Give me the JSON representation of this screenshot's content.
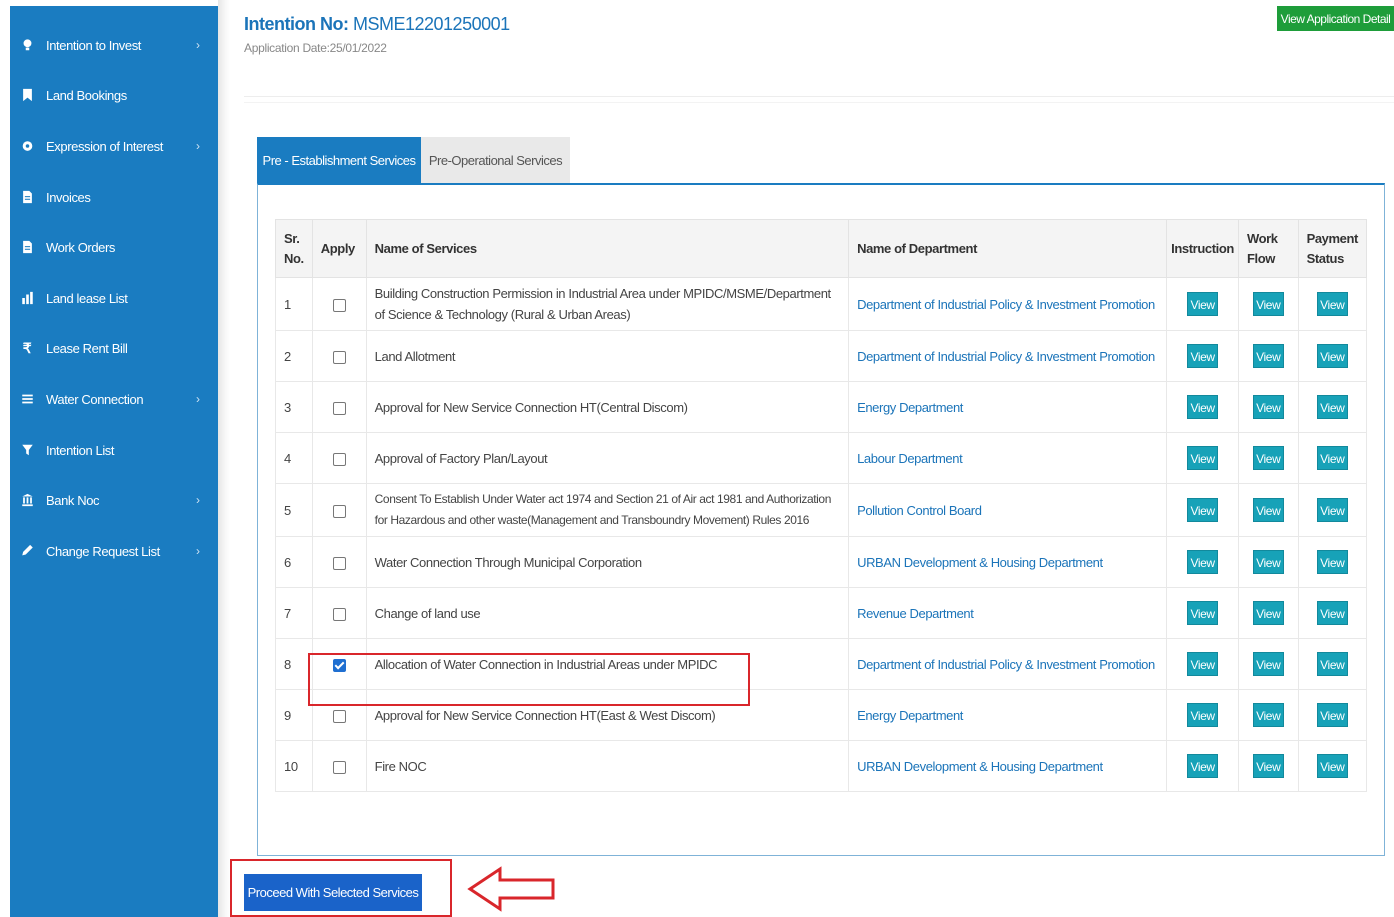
{
  "sidebar": {
    "items": [
      {
        "label": "Intention to Invest",
        "icon": "bulb-icon",
        "has_submenu": true
      },
      {
        "label": "Land Bookings",
        "icon": "bookmark-icon",
        "has_submenu": false
      },
      {
        "label": "Expression of Interest",
        "icon": "gear-icon",
        "has_submenu": true
      },
      {
        "label": "Invoices",
        "icon": "document-icon",
        "has_submenu": false
      },
      {
        "label": "Work Orders",
        "icon": "document-icon",
        "has_submenu": false
      },
      {
        "label": "Land lease List",
        "icon": "chart-icon",
        "has_submenu": false
      },
      {
        "label": "Lease Rent Bill",
        "icon": "rupee-icon",
        "has_submenu": false
      },
      {
        "label": "Water Connection",
        "icon": "list-icon",
        "has_submenu": true
      },
      {
        "label": "Intention List",
        "icon": "funnel-icon",
        "has_submenu": false
      },
      {
        "label": "Bank Noc",
        "icon": "bank-icon",
        "has_submenu": true
      },
      {
        "label": "Change Request List",
        "icon": "pencil-icon",
        "has_submenu": true
      }
    ],
    "chevron": "›"
  },
  "header": {
    "intention_label": "Intention No:",
    "intention_no": "MSME12201250001",
    "application_date": "Application Date:25/01/2022",
    "view_application_button": "View Application Detail"
  },
  "tabs": [
    {
      "label": "Pre - Establishment Services",
      "active": true
    },
    {
      "label": "Pre-Operational Services",
      "active": false
    }
  ],
  "table": {
    "headers": {
      "sr_no": "Sr. No.",
      "apply": "Apply",
      "service_name": "Name of Services",
      "department": "Name of Department",
      "instruction": "Instruction",
      "work_flow": "Work Flow",
      "payment_status": "Payment Status"
    },
    "view_label": "View",
    "rows": [
      {
        "sr": "1",
        "checked": false,
        "service": "Building Construction Permission in Industrial Area under MPIDC/MSME/Department of Science & Technology (Rural & Urban Areas)",
        "department": "Department of Industrial Policy & Investment Promotion"
      },
      {
        "sr": "2",
        "checked": false,
        "service": "Land Allotment",
        "department": "Department of Industrial Policy & Investment Promotion"
      },
      {
        "sr": "3",
        "checked": false,
        "service": "Approval for New Service Connection HT(Central Discom)",
        "department": "Energy Department"
      },
      {
        "sr": "4",
        "checked": false,
        "service": "Approval of Factory Plan/Layout",
        "department": "Labour Department"
      },
      {
        "sr": "5",
        "checked": false,
        "service": "Consent To Establish Under Water act 1974 and Section 21 of Air act 1981 and Authorization for Hazardous and other waste(Management and Transboundry Movement) Rules 2016",
        "department": "Pollution Control Board"
      },
      {
        "sr": "6",
        "checked": false,
        "service": "Water Connection Through Municipal Corporation",
        "department": "URBAN Development & Housing Department"
      },
      {
        "sr": "7",
        "checked": false,
        "service": "Change of land use",
        "department": "Revenue Department"
      },
      {
        "sr": "8",
        "checked": true,
        "service": "Allocation of Water Connection in Industrial Areas under MPIDC",
        "department": "Department of Industrial Policy & Investment Promotion"
      },
      {
        "sr": "9",
        "checked": false,
        "service": "Approval for New Service Connection HT(East & West Discom)",
        "department": "Energy Department"
      },
      {
        "sr": "10",
        "checked": false,
        "service": "Fire NOC",
        "department": "URBAN Development & Housing Department"
      }
    ]
  },
  "footer": {
    "proceed_button": "Proceed With Selected Services"
  },
  "colors": {
    "sidebar": "#1a7cc1",
    "view_button": "#17a2b8",
    "highlight": "#d9262b",
    "green_button": "#1e9d3a"
  }
}
